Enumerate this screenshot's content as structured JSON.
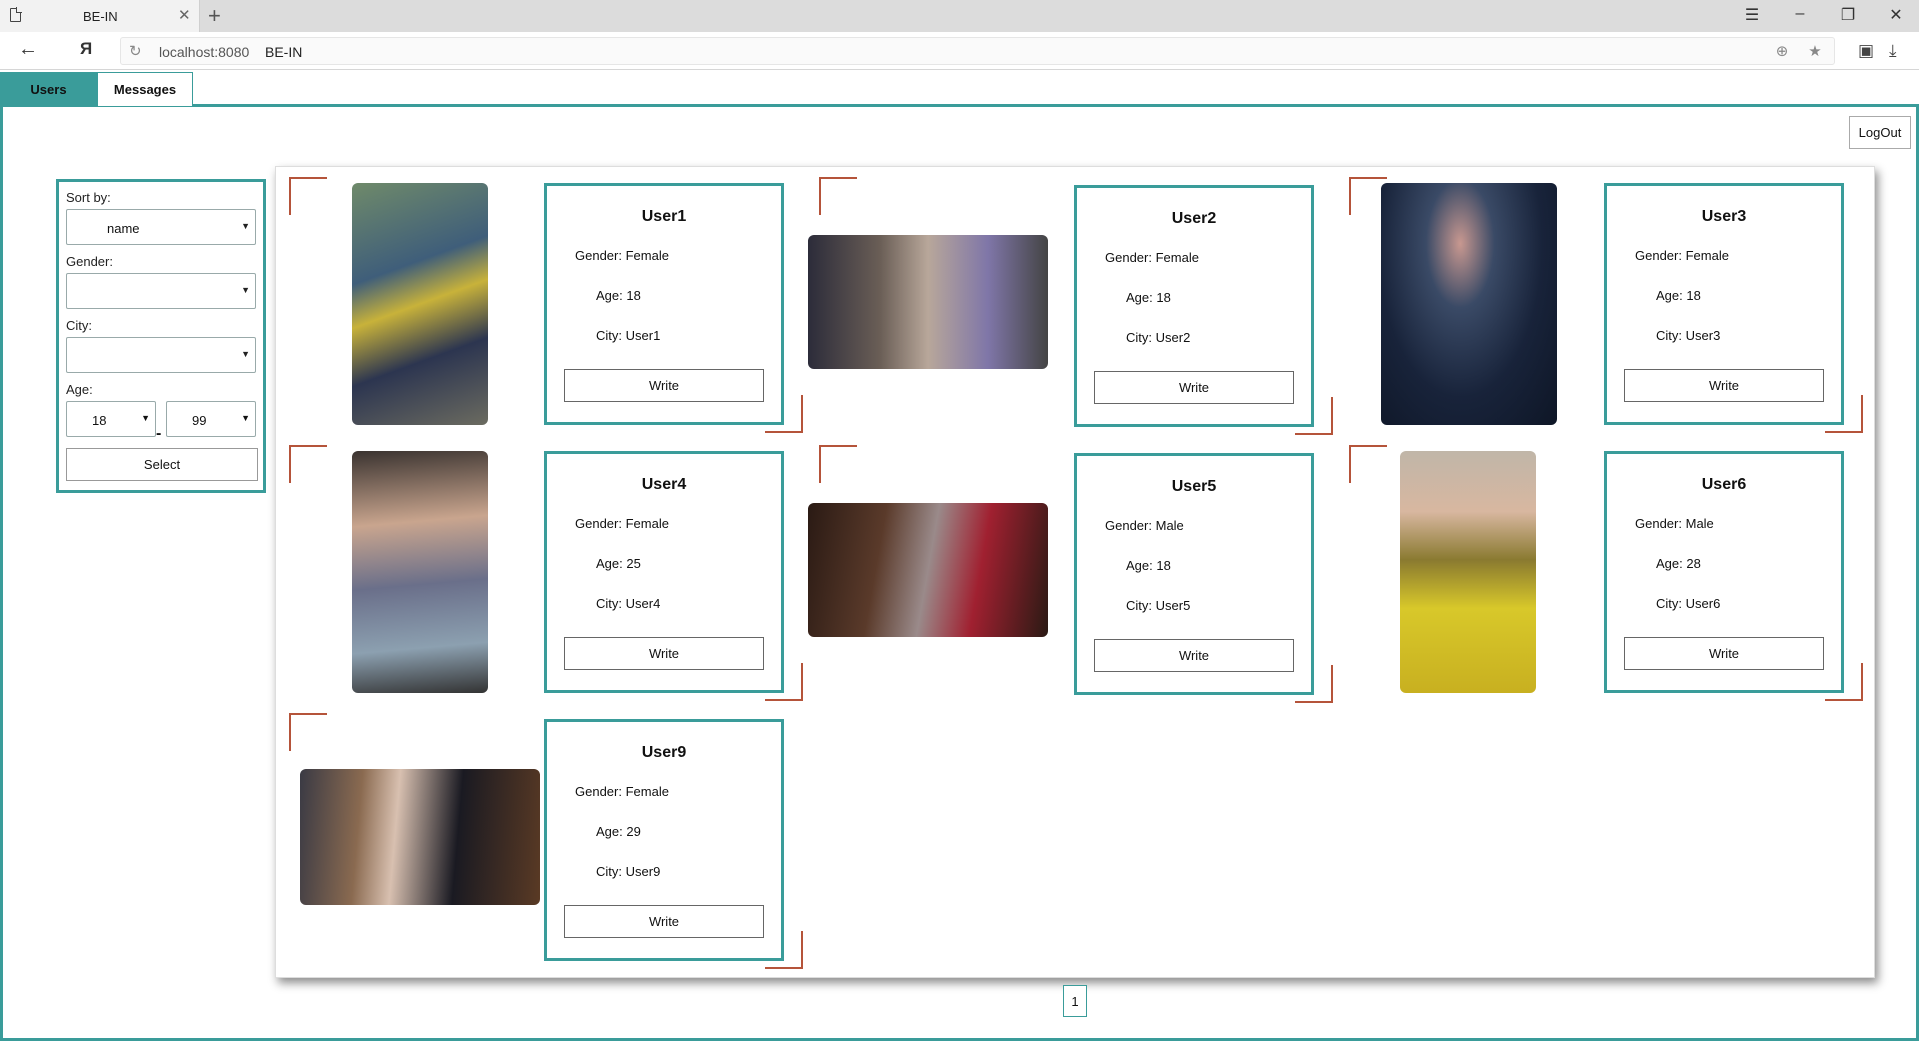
{
  "browser": {
    "tab_title": "BE-IN",
    "url_host": "localhost:8080",
    "url_title": "BE-IN"
  },
  "app": {
    "tabs": [
      {
        "label": "Users",
        "active": true
      },
      {
        "label": "Messages",
        "active": false
      }
    ],
    "logout_label": "LogOut",
    "accent_color": "#3a9c9a",
    "corner_color": "#b5543a"
  },
  "filter": {
    "sort_label": "Sort by:",
    "sort_value": "name",
    "gender_label": "Gender:",
    "gender_value": "",
    "city_label": "City:",
    "city_value": "",
    "age_label": "Age:",
    "age_from": "18",
    "age_to": "99",
    "age_separator": "-",
    "select_label": "Select"
  },
  "users": [
    {
      "name": "User1",
      "gender_key": "Gender:",
      "gender": "Female",
      "age_key": "Age:",
      "age": "18",
      "city_key": "City:",
      "city": "User1",
      "write": "Write"
    },
    {
      "name": "User2",
      "gender_key": "Gender:",
      "gender": "Female",
      "age_key": "Age:",
      "age": "18",
      "city_key": "City:",
      "city": "User2",
      "write": "Write"
    },
    {
      "name": "User3",
      "gender_key": "Gender:",
      "gender": "Female",
      "age_key": "Age:",
      "age": "18",
      "city_key": "City:",
      "city": "User3",
      "write": "Write"
    },
    {
      "name": "User4",
      "gender_key": "Gender:",
      "gender": "Female",
      "age_key": "Age:",
      "age": "25",
      "city_key": "City:",
      "city": "User4",
      "write": "Write"
    },
    {
      "name": "User5",
      "gender_key": "Gender:",
      "gender": "Male",
      "age_key": "Age:",
      "age": "18",
      "city_key": "City:",
      "city": "User5",
      "write": "Write"
    },
    {
      "name": "User6",
      "gender_key": "Gender:",
      "gender": "Male",
      "age_key": "Age:",
      "age": "28",
      "city_key": "City:",
      "city": "User6",
      "write": "Write"
    },
    {
      "name": "User9",
      "gender_key": "Gender:",
      "gender": "Female",
      "age_key": "Age:",
      "age": "29",
      "city_key": "City:",
      "city": "User9",
      "write": "Write"
    }
  ],
  "pagination": {
    "current": "1"
  }
}
